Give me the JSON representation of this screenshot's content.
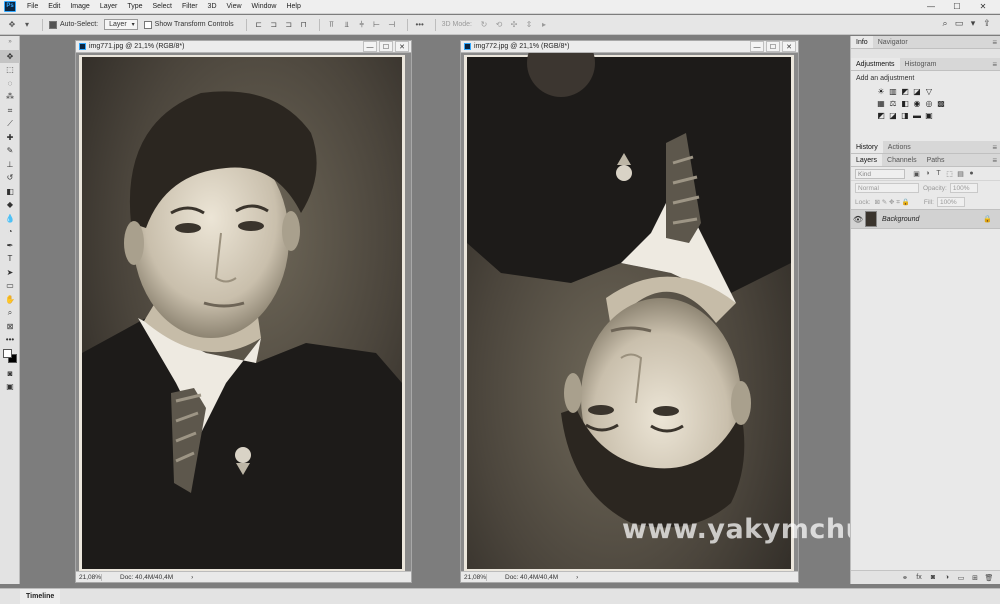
{
  "menubar": {
    "logo": "Ps",
    "items": [
      "File",
      "Edit",
      "Image",
      "Layer",
      "Type",
      "Select",
      "Filter",
      "3D",
      "View",
      "Window",
      "Help"
    ],
    "window_controls": [
      "—",
      "☐",
      "✕"
    ]
  },
  "options": {
    "auto_select_label": "Auto-Select:",
    "auto_select_value": "Layer",
    "transform_label": "Show Transform Controls",
    "mode_3d_label": "3D Mode:"
  },
  "documents": [
    {
      "title": "img771.jpg @ 21,1% (RGB/8*)",
      "zoom": "21,08%",
      "doc_info": "Doc: 40,4M/40,4M"
    },
    {
      "title": "img772.jpg @ 21,1% (RGB/8*)",
      "zoom": "21,08%",
      "doc_info": "Doc: 40,4M/40,4M"
    }
  ],
  "panels": {
    "top_tabs": [
      "Info",
      "Navigator"
    ],
    "adj_tabs": [
      "Adjustments",
      "Histogram"
    ],
    "adj_hint": "Add an adjustment",
    "history_tabs": [
      "History",
      "Actions"
    ],
    "layer_tabs": [
      "Layers",
      "Channels",
      "Paths"
    ],
    "filter_kind": "Kind",
    "blend_mode": "Normal",
    "opacity_label": "Opacity:",
    "opacity_value": "100%",
    "lock_label": "Lock:",
    "fill_label": "Fill:",
    "fill_value": "100%",
    "layer_name": "Background"
  },
  "timeline_label": "Timeline",
  "watermark": "www.yakymchuk.net",
  "colors": {
    "accent": "#31a8ff",
    "photo_bg": "#3a342d"
  }
}
